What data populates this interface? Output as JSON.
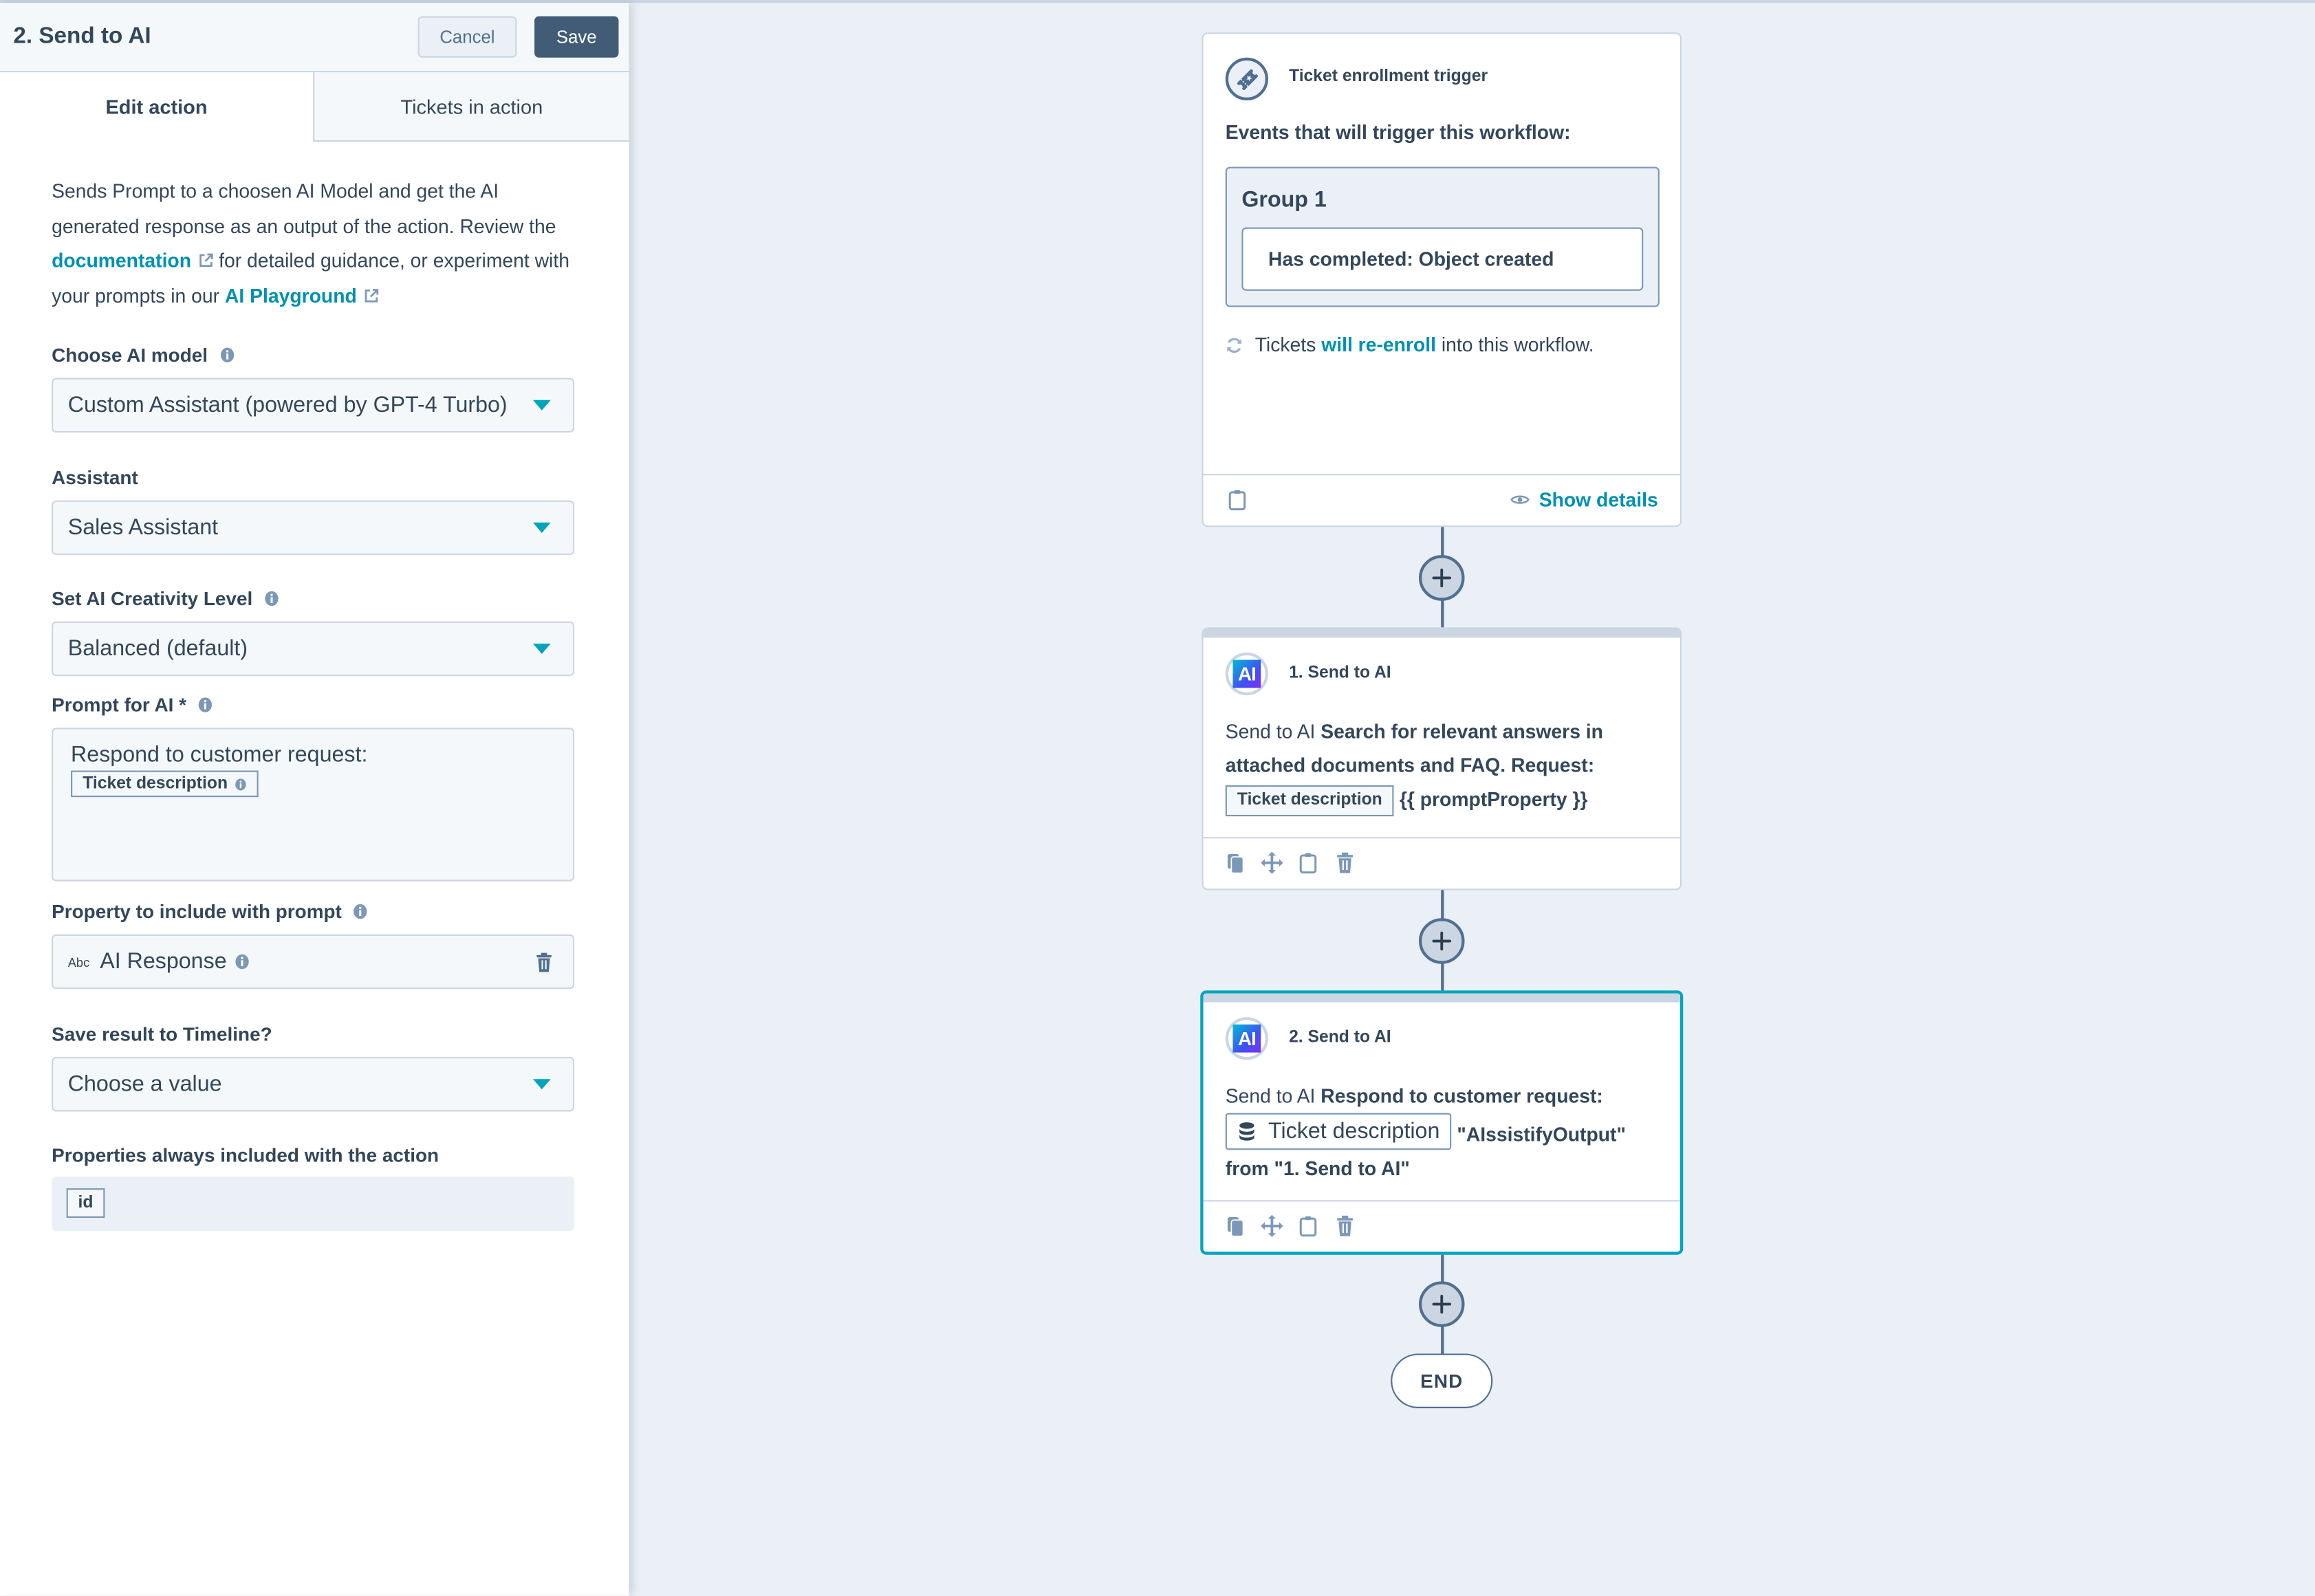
{
  "panel": {
    "title": "2. Send to AI",
    "cancel_label": "Cancel",
    "save_label": "Save",
    "tabs": [
      {
        "label": "Edit action",
        "active": true
      },
      {
        "label": "Tickets in action",
        "active": false
      }
    ],
    "description": {
      "part1": "Sends Prompt to a choosen AI Model and get the AI generated response as an output of the action. Review the ",
      "doc_link": "documentation",
      "part2": " for detailed guidance, or experiment with your prompts in our ",
      "playground_link": "AI Playground"
    },
    "fields": {
      "ai_model": {
        "label": "Choose AI model",
        "value": "Custom Assistant (powered by GPT-4 Turbo)"
      },
      "assistant": {
        "label": "Assistant",
        "value": "Sales Assistant"
      },
      "creativity": {
        "label": "Set AI Creativity Level",
        "value": "Balanced (default)"
      },
      "prompt": {
        "label": "Prompt for AI *",
        "text": "Respond to customer request:",
        "token": "Ticket description"
      },
      "property": {
        "label": "Property to include with prompt",
        "type_badge": "Abc",
        "value": "AI Response"
      },
      "timeline": {
        "label": "Save result to Timeline?",
        "value": "Choose a value"
      },
      "always_included": {
        "label": "Properties always included with the action",
        "chips": [
          "id"
        ]
      }
    }
  },
  "canvas": {
    "trigger": {
      "title": "Ticket enrollment trigger",
      "events_label": "Events that will trigger this workflow:",
      "group_title": "Group 1",
      "condition": "Has completed: Object created",
      "reenroll_pre": "Tickets ",
      "reenroll_link": "will re-enroll",
      "reenroll_post": " into this workflow.",
      "show_details": "Show details"
    },
    "actions": [
      {
        "title": "1. Send to AI",
        "badge": "AI",
        "prefix": "Send to AI ",
        "bold_text": "Search for relevant answers in attached documents and FAQ. Request:",
        "token": "Ticket description",
        "suffix": "{{ promptProperty }}"
      },
      {
        "title": "2. Send to AI",
        "badge": "AI",
        "prefix": "Send to AI ",
        "bold_text": "Respond to customer request:",
        "token": "Ticket description",
        "suffix": "\"AIssistifyOutput\" from \"1. Send to AI\"",
        "selected": true
      }
    ],
    "end_label": "END"
  },
  "colors": {
    "accent": "#00a4bd",
    "link": "#0091ae",
    "primary_button": "#425b76",
    "text": "#33475b",
    "canvas_bg": "#eaf0f6"
  }
}
